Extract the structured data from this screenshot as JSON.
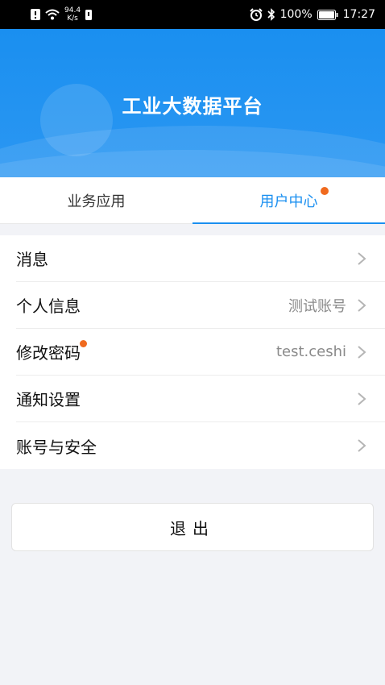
{
  "status_bar": {
    "net_speed_value": "94.4",
    "net_speed_unit": "K/s",
    "battery": "100%",
    "time": "17:27"
  },
  "header": {
    "title": "工业大数据平台"
  },
  "tabs": [
    {
      "label": "业务应用",
      "active": false
    },
    {
      "label": "用户中心",
      "active": true,
      "badge": true
    }
  ],
  "menu": [
    {
      "label": "消息",
      "value": ""
    },
    {
      "label": "个人信息",
      "value": "测试账号"
    },
    {
      "label": "修改密码",
      "value": "test.ceshi",
      "badge": true
    },
    {
      "label": "通知设置",
      "value": ""
    },
    {
      "label": "账号与安全",
      "value": ""
    }
  ],
  "logout_label": "退出",
  "colors": {
    "accent": "#1a8ff0",
    "badge": "#f06a1e"
  },
  "icons": [
    "warning-icon",
    "wifi-icon",
    "sim-icon",
    "alarm-icon",
    "bluetooth-icon",
    "battery-icon",
    "chevron-right-icon"
  ]
}
